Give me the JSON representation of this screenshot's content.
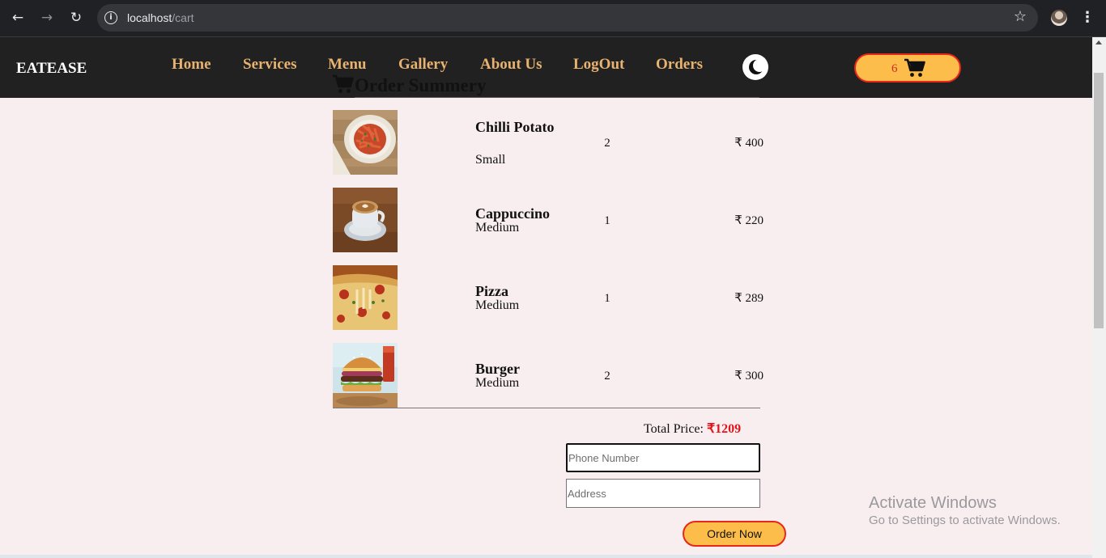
{
  "browser": {
    "url_host": "localhost",
    "url_path": "/cart",
    "icons": [
      "back-arrow-icon",
      "forward-arrow-icon",
      "reload-icon",
      "site-info-icon",
      "bookmark-star-icon",
      "profile-avatar",
      "menu-kebab-icon"
    ]
  },
  "header": {
    "brand": "EATEASE",
    "nav": [
      "Home",
      "Services",
      "Menu",
      "Gallery",
      "About Us",
      "LogOut",
      "Orders"
    ],
    "cart_count": "6",
    "colors": {
      "background": "#212121",
      "nav_link": "#e8b270",
      "cart_button": "#fdbd4a",
      "cart_border": "#e8261a"
    }
  },
  "summary": {
    "title": "Order Summery",
    "items": [
      {
        "name": "Chilli Potato",
        "size": "Small",
        "qty": "2",
        "price": "₹ 400"
      },
      {
        "name": "Cappuccino",
        "size": "Medium",
        "qty": "1",
        "price": "₹ 220"
      },
      {
        "name": "Pizza",
        "size": "Medium",
        "qty": "1",
        "price": "₹ 289"
      },
      {
        "name": "Burger",
        "size": "Medium",
        "qty": "2",
        "price": "₹ 300"
      }
    ],
    "total_label": "Total Price:",
    "total_value": "₹1209",
    "phone_placeholder": "Phone Number",
    "address_placeholder": "Address",
    "order_button": "Order Now"
  },
  "watermark": {
    "title": "Activate Windows",
    "subtitle": "Go to Settings to activate Windows."
  }
}
